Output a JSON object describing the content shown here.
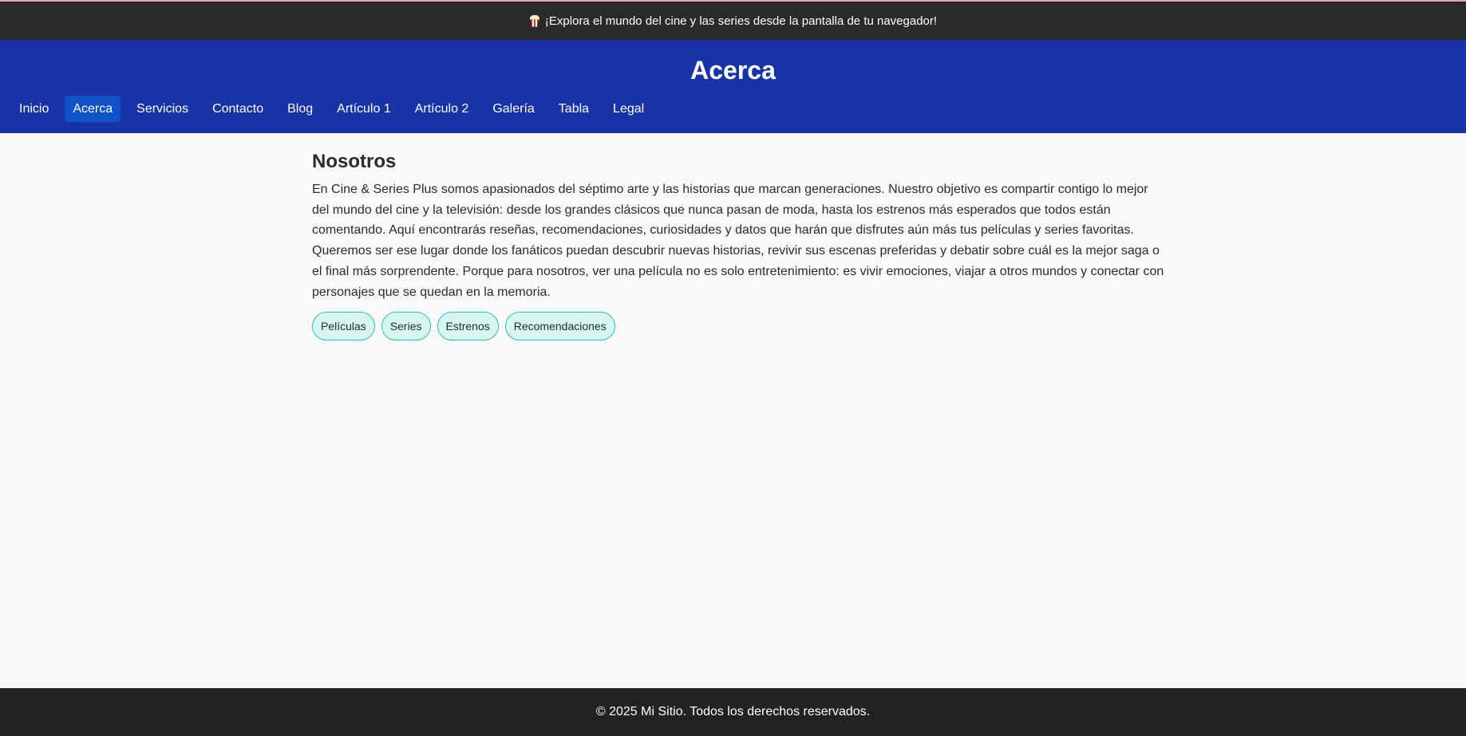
{
  "announcement": {
    "icon": "popcorn-icon",
    "text": "¡Explora el mundo del cine y las series desde la pantalla de tu navegador!"
  },
  "header": {
    "title": "Acerca",
    "nav": [
      {
        "label": "Inicio",
        "active": false
      },
      {
        "label": "Acerca",
        "active": true
      },
      {
        "label": "Servicios",
        "active": false
      },
      {
        "label": "Contacto",
        "active": false
      },
      {
        "label": "Blog",
        "active": false
      },
      {
        "label": "Artículo 1",
        "active": false
      },
      {
        "label": "Artículo 2",
        "active": false
      },
      {
        "label": "Galería",
        "active": false
      },
      {
        "label": "Tabla",
        "active": false
      },
      {
        "label": "Legal",
        "active": false
      }
    ]
  },
  "main": {
    "heading": "Nosotros",
    "paragraph": "En Cine & Series Plus somos apasionados del séptimo arte y las historias que marcan generaciones. Nuestro objetivo es compartir contigo lo mejor del mundo del cine y la televisión: desde los grandes clásicos que nunca pasan de moda, hasta los estrenos más esperados que todos están comentando. Aquí encontrarás reseñas, recomendaciones, curiosidades y datos que harán que disfrutes aún más tus películas y series favoritas. Queremos ser ese lugar donde los fanáticos puedan descubrir nuevas historias, revivir sus escenas preferidas y debatir sobre cuál es la mejor saga o el final más sorprendente. Porque para nosotros, ver una película no es solo entretenimiento: es vivir emociones, viajar a otros mundos y conectar con personajes que se quedan en la memoria.",
    "tags": [
      "Películas",
      "Series",
      "Estrenos",
      "Recomendaciones"
    ]
  },
  "footer": {
    "text": "© 2025 Mi Sitio. Todos los derechos reservados."
  },
  "colors": {
    "announcement_bg": "#2a2a2a",
    "header_bg": "#1733a6",
    "nav_active_bg": "#0f52c8",
    "page_bg": "#f9f9f9",
    "tag_bg": "#d7f6f1",
    "tag_border": "#2cc2ac",
    "footer_bg": "#222222"
  }
}
